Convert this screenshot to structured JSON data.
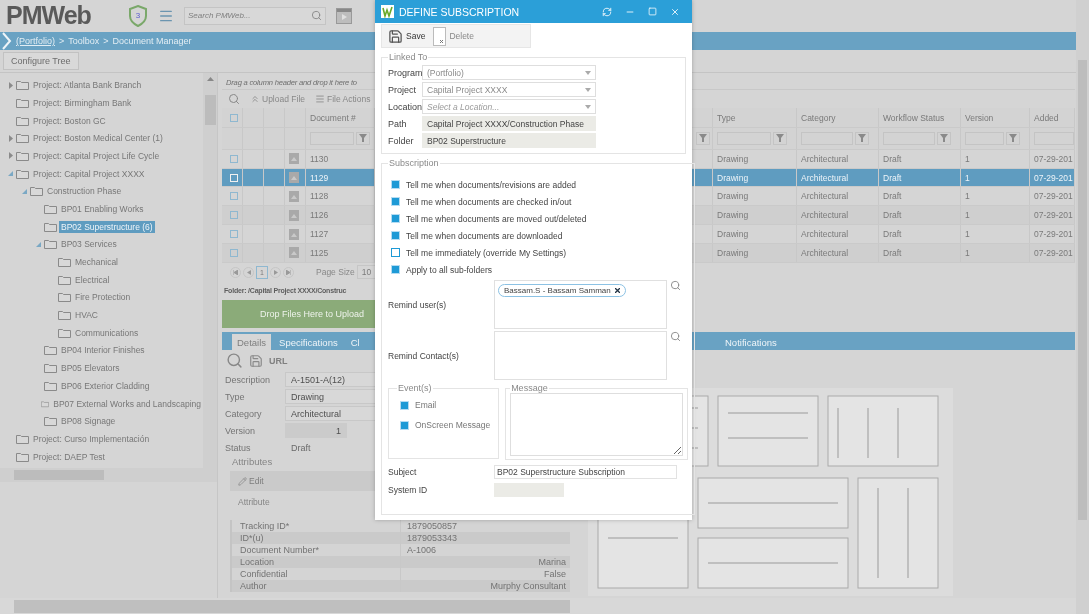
{
  "header": {
    "logo": "PMWeb",
    "badge": "3",
    "search": {
      "placeholder": "Search PMWeb..."
    }
  },
  "breadcrumb": {
    "items": [
      "(Portfolio)",
      "Toolbox",
      "Document Manager"
    ],
    "separator": ">"
  },
  "configure_button": "Configure Tree",
  "tree": [
    {
      "label": "Project: Atlanta Bank Branch",
      "expanded": false,
      "selected": false
    },
    {
      "label": "Project: Birmingham Bank",
      "selected": false
    },
    {
      "label": "Project: Boston GC",
      "selected": false
    },
    {
      "label": "Project: Boston Medical Center (1)",
      "expanded": false,
      "selected": false
    },
    {
      "label": "Project: Capital Project Life Cycle",
      "expanded": false,
      "selected": false
    },
    {
      "label": "Project: Capital Project XXXX",
      "expanded": true,
      "selected": false,
      "children": [
        {
          "label": "Construction Phase",
          "expanded": true,
          "selected": false,
          "children": [
            {
              "label": "BP01 Enabling Works",
              "selected": false
            },
            {
              "label": "BP02 Superstructure (6)",
              "selected": true
            },
            {
              "label": "BP03 Services",
              "expanded": true,
              "selected": false,
              "children": [
                {
                  "label": "Mechanical",
                  "selected": false
                },
                {
                  "label": "Electrical",
                  "selected": false
                },
                {
                  "label": "Fire Protection",
                  "selected": false
                },
                {
                  "label": "HVAC",
                  "selected": false
                },
                {
                  "label": "Communications",
                  "selected": false
                }
              ]
            },
            {
              "label": "BP04 Interior Finishes",
              "selected": false
            },
            {
              "label": "BP05 Elevators",
              "selected": false
            },
            {
              "label": "BP06 Exterior Cladding",
              "selected": false
            },
            {
              "label": "BP07 External Works and Landscaping",
              "selected": false
            },
            {
              "label": "BP08 Signage",
              "selected": false
            }
          ]
        }
      ]
    },
    {
      "label": "Project: Curso Implementación",
      "selected": false
    },
    {
      "label": "Project: DAEP Test",
      "selected": false
    }
  ],
  "grid": {
    "hint": "Drag a column header and drop it here to",
    "toolbar": [
      "Upload File",
      "File Actions"
    ],
    "select_all_checked": false,
    "columns": {
      "document": "Document #",
      "type": "Type",
      "category": "Category",
      "status": "Workflow Status",
      "version": "Version",
      "added": "Added"
    },
    "rows": [
      {
        "document": "1130",
        "type": "Drawing",
        "category": "Architectural",
        "status": "Draft",
        "version": "1",
        "added": "07-29-201",
        "selected": false
      },
      {
        "document": "1129",
        "type": "Drawing",
        "category": "Architectural",
        "status": "Draft",
        "version": "1",
        "added": "07-29-201",
        "selected": true
      },
      {
        "document": "1128",
        "type": "Drawing",
        "category": "Architectural",
        "status": "Draft",
        "version": "1",
        "added": "07-29-201",
        "selected": false
      },
      {
        "document": "1126",
        "type": "Drawing",
        "category": "Architectural",
        "status": "Draft",
        "version": "1",
        "added": "07-29-201",
        "selected": false
      },
      {
        "document": "1127",
        "type": "Drawing",
        "category": "Architectural",
        "status": "Draft",
        "version": "1",
        "added": "07-29-201",
        "selected": false
      },
      {
        "document": "1125",
        "type": "Drawing",
        "category": "Architectural",
        "status": "Draft",
        "version": "1",
        "added": "07-29-201",
        "selected": false
      }
    ],
    "pager": {
      "page": "1",
      "page_size_label": "Page Size",
      "page_size": "10"
    },
    "folder": "Folder: /Capital Project XXXX/Construc"
  },
  "drop_zone": "Drop Files Here to Upload",
  "tabs": [
    {
      "label": "Details",
      "selected": true
    },
    {
      "label": "Specifications",
      "selected": false
    },
    {
      "label": "Cl",
      "selected": false
    },
    {
      "label": "Notifications",
      "selected": false
    }
  ],
  "details": {
    "toolbar_link": "URL",
    "fields": [
      {
        "label": "Description",
        "value": "A-1501-A(12)",
        "kind": "text"
      },
      {
        "label": "Type",
        "value": "Drawing",
        "kind": "text"
      },
      {
        "label": "Category",
        "value": "Architectural",
        "kind": "text"
      },
      {
        "label": "Version",
        "value": "1",
        "kind": "number"
      },
      {
        "label": "Status",
        "value": "Draft",
        "kind": "plain"
      }
    ],
    "attributes": {
      "title": "Attributes",
      "edit": "Edit",
      "header": "Attribute",
      "rows": [
        {
          "name": "Tracking ID*",
          "value": "1879050857",
          "right_aligned": false
        },
        {
          "name": "ID*(u)",
          "value": "1879053343",
          "right_aligned": false
        },
        {
          "name": "Document Number*",
          "value": "A-1006",
          "right_aligned": false
        },
        {
          "name": "Location",
          "value": "Marina",
          "right_aligned": true
        },
        {
          "name": "Confidential",
          "value": "False",
          "right_aligned": true
        },
        {
          "name": "Author",
          "value": "Murphy Consultant",
          "right_aligned": true
        }
      ]
    }
  },
  "dialog": {
    "title": "DEFINE SUBSCRIPTION",
    "buttons": [
      {
        "label": "Save",
        "kind": "save",
        "disabled": false
      },
      {
        "label": "Delete",
        "kind": "delete",
        "disabled": true
      }
    ],
    "linked_to": {
      "legend": "Linked To",
      "fields": [
        {
          "label": "Program",
          "kind": "select",
          "value": "(Portfolio)"
        },
        {
          "label": "Project",
          "kind": "select",
          "value": "Capital Project XXXX"
        },
        {
          "label": "Location",
          "kind": "select",
          "placeholder": "Select a Location..."
        },
        {
          "label": "Path",
          "kind": "readonly",
          "value": "Capital Project XXXX/Construction Phase"
        },
        {
          "label": "Folder",
          "kind": "readonly",
          "value": "BP02 Superstructure"
        }
      ]
    },
    "subscription": {
      "legend": "Subscription",
      "options": [
        {
          "label": "Tell me when documents/revisions are added",
          "checked": true
        },
        {
          "label": "Tell me when documents are checked in/out",
          "checked": true
        },
        {
          "label": "Tell me when documents are moved out/deleted",
          "checked": true
        },
        {
          "label": "Tell me when documents are downloaded",
          "checked": true
        },
        {
          "label": "Tell me immediately (override My Settings)",
          "checked": false
        },
        {
          "label": "Apply to all sub-folders",
          "checked": true
        }
      ],
      "remind_users": {
        "label": "Remind user(s)",
        "chips": [
          "Bassam.S - Bassam Samman"
        ]
      },
      "remind_contacts": {
        "label": "Remind Contact(s)"
      },
      "events": {
        "legend": "Event(s)",
        "options": [
          {
            "label": "Email",
            "checked": true
          },
          {
            "label": "OnScreen Message",
            "checked": true
          }
        ]
      },
      "message": {
        "legend": "Message"
      },
      "subject": {
        "label": "Subject",
        "value": "BP02 Superstructure Subscription"
      },
      "system_id": {
        "label": "System ID"
      }
    }
  }
}
